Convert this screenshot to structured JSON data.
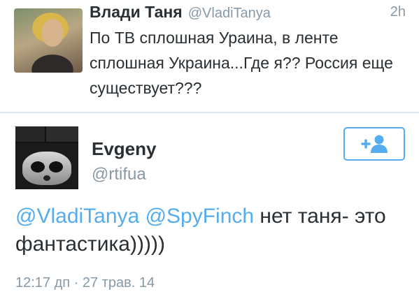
{
  "tweet1": {
    "name": "Влади Таня",
    "handle": "@VladiTanya",
    "time": "2h",
    "text": "По ТВ сплошная Ураина, в ленте сплошная Украина...Где я?? Россия еще существует???"
  },
  "tweet2": {
    "name": "Evgeny",
    "handle": "@rtifua",
    "follow_icon": "add-user-icon",
    "mention1": "@VladiTanya",
    "mention2": "@SpyFinch",
    "text_rest": "нет таня- это фантастика)))))",
    "timestamp": "12:17 дп · 27 трав. 14"
  },
  "colors": {
    "accent": "#55acee",
    "muted": "#8899a6",
    "text": "#292f33",
    "divider": "#e1e8ed"
  }
}
